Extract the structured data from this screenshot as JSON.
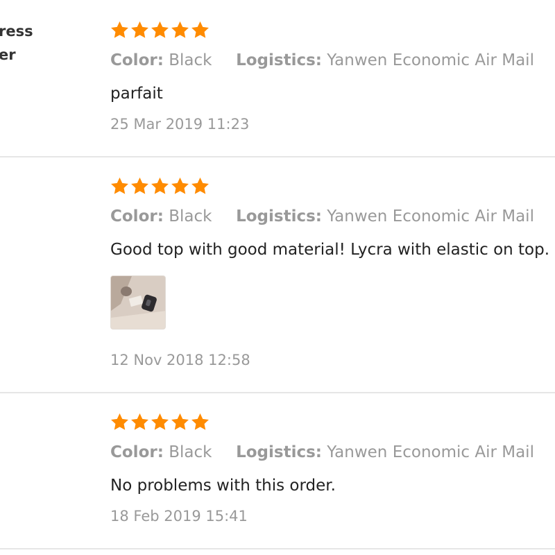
{
  "reviews": [
    {
      "buyer_lines": [
        "ress",
        "er"
      ],
      "rating_stars": 5,
      "meta": {
        "color_label": "Color:",
        "color_value": "Black",
        "logistics_label": "Logistics:",
        "logistics_value": "Yanwen Economic Air Mail"
      },
      "feedback": "parfait",
      "date": "25 Mar 2019 11:23"
    },
    {
      "buyer_lines": [],
      "rating_stars": 5,
      "meta": {
        "color_label": "Color:",
        "color_value": "Black",
        "logistics_label": "Logistics:",
        "logistics_value": "Yanwen Economic Air Mail"
      },
      "feedback": "Good top with good material! Lycra with elastic on top.",
      "has_photo": true,
      "date": "12 Nov 2018 12:58"
    },
    {
      "buyer_lines": [],
      "rating_stars": 5,
      "meta": {
        "color_label": "Color:",
        "color_value": "Black",
        "logistics_label": "Logistics:",
        "logistics_value": "Yanwen Economic Air Mail"
      },
      "feedback": "No problems with this order.",
      "date": "18 Feb 2019 15:41"
    }
  ],
  "colors": {
    "star": "#ff8b00",
    "meta_text": "#999999",
    "divider": "#e6e6e6"
  },
  "icons": {
    "star": "star-icon"
  }
}
